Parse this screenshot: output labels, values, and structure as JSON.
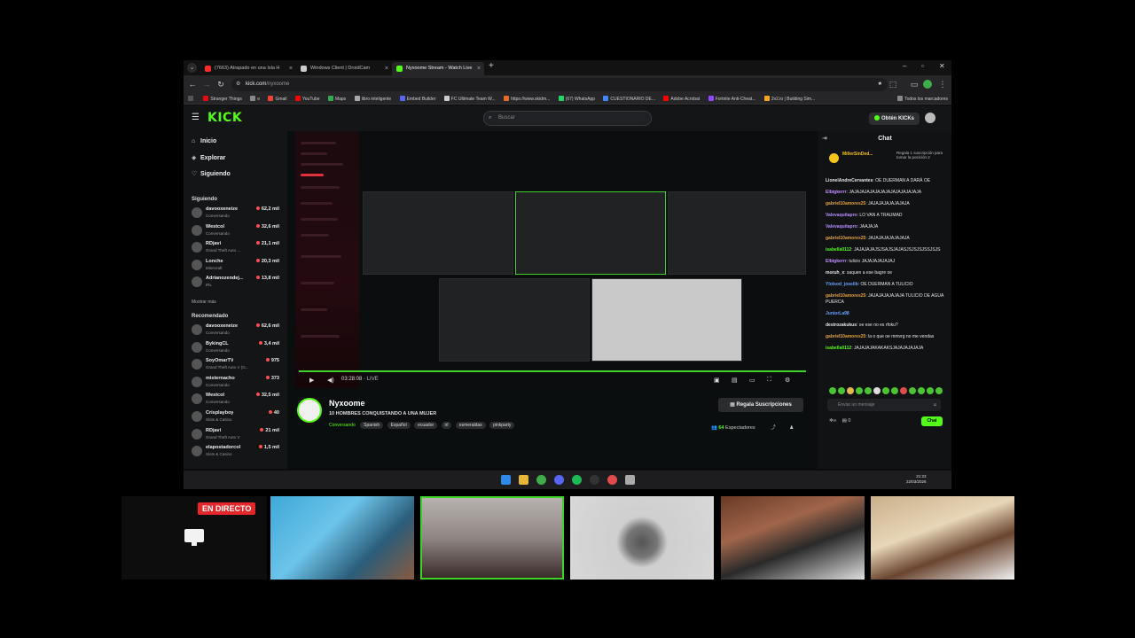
{
  "browser": {
    "tabs": [
      {
        "label": "(7663) Atrapado en una Isla H",
        "color": "#ff2b2b"
      },
      {
        "label": "Windows Client | DroidCam",
        "color": "#cccccc"
      },
      {
        "label": "Nyxoome Stream - Watch Live",
        "color": "#53fc18"
      }
    ],
    "url_domain": "kick.com",
    "url_path": "/nyxoome",
    "bookmarks": [
      {
        "label": "Stranger Things",
        "color": "#e50914"
      },
      {
        "label": "e",
        "color": "#888888"
      },
      {
        "label": "Gmail",
        "color": "#ea4335"
      },
      {
        "label": "YouTube",
        "color": "#ff0000"
      },
      {
        "label": "Maps",
        "color": "#34a853"
      },
      {
        "label": "libro inteligente",
        "color": "#aaaaaa"
      },
      {
        "label": "Embed Builder",
        "color": "#5865f2"
      },
      {
        "label": "FC Ultimate Team W...",
        "color": "#cccccc"
      },
      {
        "label": "https://www.skidm...",
        "color": "#e36b2e"
      },
      {
        "label": "(67) WhatsApp",
        "color": "#25d366"
      },
      {
        "label": "CUESTIONARIO DE...",
        "color": "#4285f4"
      },
      {
        "label": "Adobe Acrobat",
        "color": "#ff0000"
      },
      {
        "label": "Fortnite Anti-Cheat...",
        "color": "#9146ff"
      },
      {
        "label": "2v2.io | Building Sim...",
        "color": "#f5a623"
      },
      {
        "label": "Todos los marcadores",
        "color": "#888888"
      }
    ]
  },
  "site": {
    "logo": "KICK",
    "search_placeholder": "Buscar",
    "kicks_button": "Obtén KICKs",
    "nav": [
      {
        "label": "Inicio",
        "icon": "home-icon"
      },
      {
        "label": "Explorar",
        "icon": "compass-icon"
      },
      {
        "label": "Siguiendo",
        "icon": "heart-icon"
      }
    ],
    "following_title": "Siguiendo",
    "following": [
      {
        "name": "davooxeneize",
        "category": "Conversando",
        "viewers": "62,2 mil"
      },
      {
        "name": "Westcol",
        "category": "Conversando",
        "viewers": "32,6 mil"
      },
      {
        "name": "RDjavi",
        "category": "Grand Theft Auto ...",
        "viewers": "21,1 mil"
      },
      {
        "name": "Lonche",
        "category": "Minecraft",
        "viewers": "20,3 mil"
      },
      {
        "name": "Adrianozendej...",
        "category": "IRL",
        "viewers": "13,8 mil"
      }
    ],
    "show_more": "Mostrar más",
    "recommended_title": "Recomendado",
    "recommended": [
      {
        "name": "davooxeneize",
        "category": "Conversando",
        "viewers": "62,6 mil"
      },
      {
        "name": "BykingCL",
        "category": "Conversando",
        "viewers": "3,4 mil"
      },
      {
        "name": "SoyOmarTV",
        "category": "Grand Theft Auto V (G...",
        "viewers": "975"
      },
      {
        "name": "misternacho",
        "category": "Conversando",
        "viewers": "373"
      },
      {
        "name": "Westcol",
        "category": "Conversando",
        "viewers": "32,5 mil"
      },
      {
        "name": "Crisplayboy",
        "category": "Slots & Casino",
        "viewers": "40"
      },
      {
        "name": "RDjavi",
        "category": "Grand Theft Auto V",
        "viewers": "21 mil"
      },
      {
        "name": "elapostadorcol",
        "category": "Slots & Casino",
        "viewers": "1,5 mil"
      }
    ],
    "player": {
      "time": "03:28:08",
      "live_label": "LIVE",
      "progress": 1.0
    },
    "stream": {
      "streamer": "Nyxoome",
      "title": "10 HOMBRES CONQUISTANDO A UNA MUJER",
      "category": "Conversando",
      "tags": [
        "Spanish",
        "Español",
        "ecuador",
        "irl",
        "esmeraldas",
        "pinkparty"
      ],
      "subs_button": "Regala Suscripciones",
      "viewers": "64",
      "viewers_label": "Espectadores"
    },
    "chat": {
      "title": "Chat",
      "pinned_user": "MillerSinDed...",
      "pinned_text": "Regala 1 suscripción para tomar la posición 2",
      "messages": [
        {
          "user": "LionelAndreCervantes",
          "color": "#e6e6e6",
          "text": ": OE DUERMAN A DARÁ OE"
        },
        {
          "user": "Elbigkerrr",
          "color": "#c38cff",
          "text": ": JAJAJAJAJAJAJAJAJAJAJAJAJAJA"
        },
        {
          "user": "gabriel10amores25",
          "color": "#e0a040",
          "text": ": JAJAJAJAJAJAJAJA"
        },
        {
          "user": "Valevaquitapro",
          "color": "#b58cff",
          "text": ": LO VAN A TRAUMAD"
        },
        {
          "user": "Valevaquitapro",
          "color": "#b58cff",
          "text": ": JAAJAJA"
        },
        {
          "user": "gabriel10amores25",
          "color": "#e0a040",
          "text": ": JAJAJAJAJAJAJAJA"
        },
        {
          "user": "isabella0112",
          "color": "#53fc18",
          "text": ": JAJAJAJAJSJSAJSJAJASJSJSJSJSSJSJS"
        },
        {
          "user": "Elbigkerrr",
          "color": "#c38cff",
          "text": ": tulicio JAJAJAJAJAJAJ"
        },
        {
          "user": "moruh_x",
          "color": "#e6e6e6",
          "text": ": saquen a ese bagre oe"
        },
        {
          "user": "Ylolsod_joselib",
          "color": "#6aa0ff",
          "text": ": OE DUERMAN A TULICIO"
        },
        {
          "user": "gabriel10amores25",
          "color": "#e0a040",
          "text": ": JAJAJAJAJAJAJA TULICIO DE AGUA PUERCA"
        },
        {
          "user": "JuniorLa98",
          "color": "#6aa0ff",
          "text": ""
        },
        {
          "user": "destrozakukus",
          "color": "#e6e6e6",
          "text": ": oe ese no es rfoku?"
        },
        {
          "user": "gabriel10amores25",
          "color": "#e0a040",
          "text": ": la o que oe mmvrg no me vendas"
        },
        {
          "user": "isabella0112",
          "color": "#53fc18",
          "text": ": JAJAJAJAKAKAKSJAJAJAJAJAJA"
        }
      ],
      "input_placeholder": "Enviar un mensaje",
      "footer_count": "0",
      "send_button": "Chat"
    }
  },
  "taskbar": {
    "time": "21:23",
    "date": "22/03/2026"
  },
  "strip": {
    "live_badge": "EN DIRECTO"
  },
  "colors": {
    "kick_green": "#53fc18",
    "live_red": "#e5262b"
  }
}
